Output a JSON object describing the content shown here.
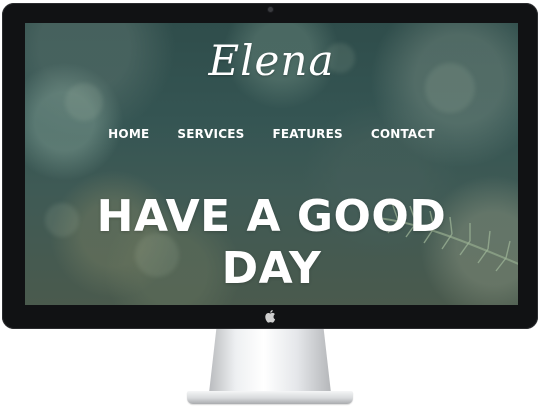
{
  "site": {
    "logo_text": "Elena",
    "nav": [
      {
        "label": "HOME"
      },
      {
        "label": "SERVICES"
      },
      {
        "label": "FEATURES"
      },
      {
        "label": "CONTACT"
      }
    ],
    "headline_line1": "HAVE A GOOD",
    "headline_line2": "DAY"
  },
  "device": {
    "chin_icon": "apple-logo-icon",
    "camera_icon": "camera-icon"
  },
  "colors": {
    "bezel": "#111214",
    "screen_tint": "#355553",
    "text": "#ffffff"
  }
}
